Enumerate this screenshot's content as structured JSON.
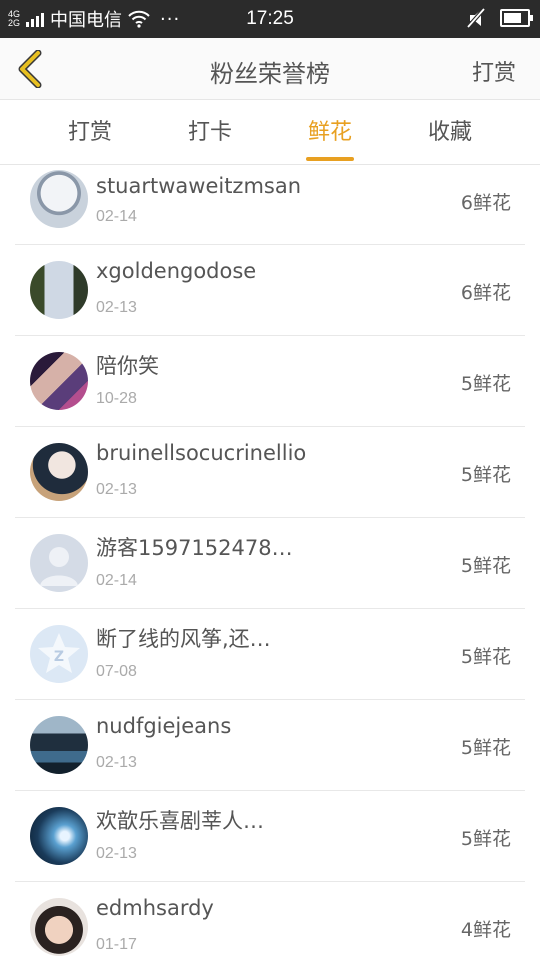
{
  "status_bar": {
    "network_top": "4G",
    "network_bottom": "2G",
    "carrier": "中国电信",
    "more": "···",
    "time": "17:25",
    "battery_level": 0.75
  },
  "header": {
    "title": "粉丝荣誉榜",
    "action": "打赏"
  },
  "tabs": [
    {
      "label": "打赏",
      "active": false
    },
    {
      "label": "打卡",
      "active": false
    },
    {
      "label": "鲜花",
      "active": true
    },
    {
      "label": "收藏",
      "active": false
    }
  ],
  "rows": [
    {
      "name": "stuartwaweitzmsan",
      "date": "02-14",
      "count": "6鲜花"
    },
    {
      "name": "xgoldengodose",
      "date": "02-13",
      "count": "6鲜花"
    },
    {
      "name": "陪你笑",
      "date": "10-28",
      "count": "5鲜花"
    },
    {
      "name": "bruinellsocucrinellio",
      "date": "02-13",
      "count": "5鲜花"
    },
    {
      "name": "游客1597152478…",
      "date": "02-14",
      "count": "5鲜花"
    },
    {
      "name": "断了线的风筝,还…",
      "date": "07-08",
      "count": "5鲜花"
    },
    {
      "name": "nudfgiejeans",
      "date": "02-13",
      "count": "5鲜花"
    },
    {
      "name": "欢歆乐喜剧莘人…",
      "date": "02-13",
      "count": "5鲜花"
    },
    {
      "name": "edmhsardy",
      "date": "01-17",
      "count": "4鲜花"
    }
  ],
  "colors": {
    "accent": "#e8a021",
    "status_bar": "#2b2b2b",
    "back_arrow": "#e8c021"
  }
}
